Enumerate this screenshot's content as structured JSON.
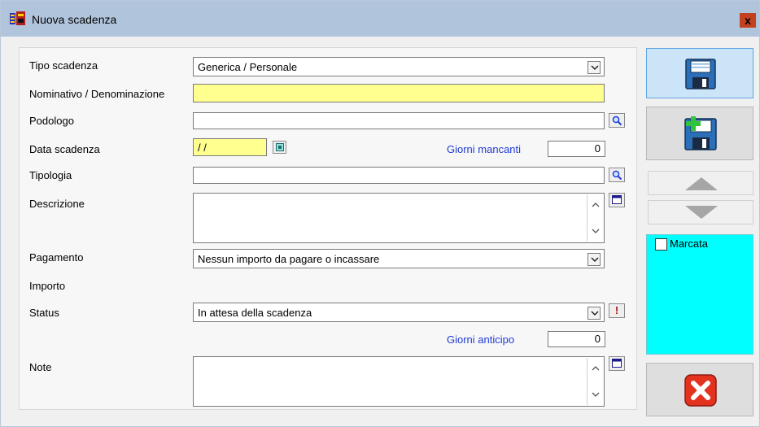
{
  "window": {
    "title": "Nuova scadenza",
    "close_glyph": "x"
  },
  "form": {
    "tipo_scadenza": {
      "label": "Tipo scadenza",
      "value": "Generica / Personale"
    },
    "nominativo": {
      "label": "Nominativo / Denominazione",
      "value": ""
    },
    "podologo": {
      "label": "Podologo",
      "value": ""
    },
    "data_scadenza": {
      "label": "Data scadenza",
      "value": " / /"
    },
    "giorni_mancanti": {
      "label": "Giorni mancanti",
      "value": "0"
    },
    "tipologia": {
      "label": "Tipologia",
      "value": ""
    },
    "descrizione": {
      "label": "Descrizione",
      "value": ""
    },
    "pagamento": {
      "label": "Pagamento",
      "value": "Nessun importo da pagare o incassare"
    },
    "importo": {
      "label": "Importo"
    },
    "status": {
      "label": "Status",
      "value": "In attesa della scadenza",
      "alert_glyph": "!"
    },
    "giorni_anticipo": {
      "label": "Giorni anticipo",
      "value": "0"
    },
    "note": {
      "label": "Note",
      "value": ""
    }
  },
  "side": {
    "marcata_label": "Marcata",
    "marcata_checked": false,
    "icons": [
      "floppy-save-icon",
      "floppy-add-icon",
      "up-arrow-icon",
      "down-arrow-icon",
      "cancel-x-icon"
    ]
  },
  "colors": {
    "yellow_field": "#ffff8f",
    "cyan_panel": "#00ffff",
    "blue_label": "#1f3ad6"
  }
}
